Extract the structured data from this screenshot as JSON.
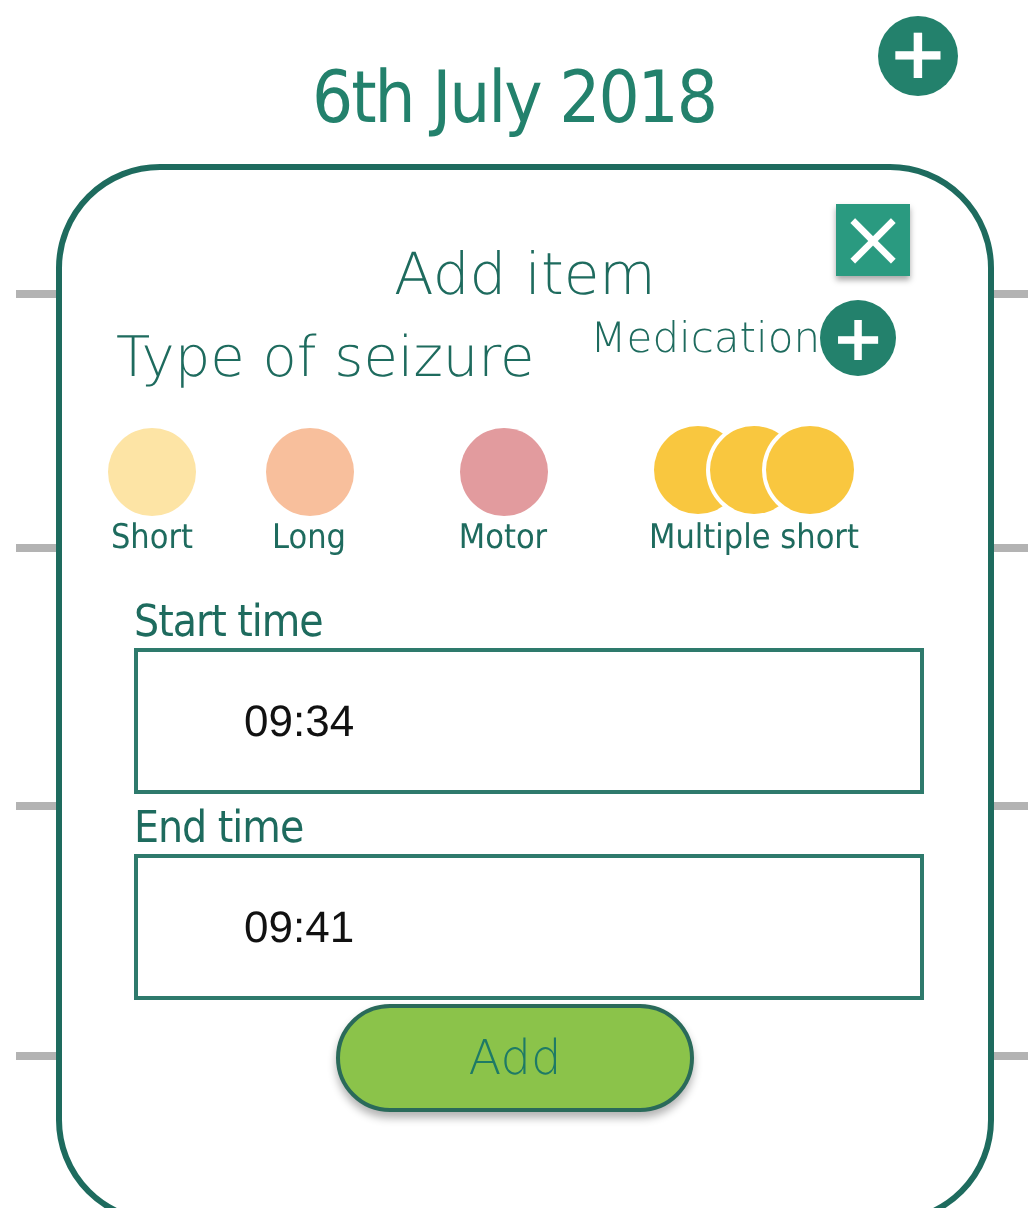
{
  "header": {
    "date": "6th July 2018",
    "add_button": "+"
  },
  "dialog": {
    "title": "Add item",
    "close": "×",
    "section_title": "Type of seizure",
    "medication": {
      "label": "Medication",
      "button": "+"
    },
    "seizure_types": [
      {
        "label": "Short",
        "kind": "single",
        "color": "#fde4a5"
      },
      {
        "label": "Long",
        "kind": "single",
        "color": "#f8bf9c"
      },
      {
        "label": "Motor",
        "kind": "single",
        "color": "#e29b9e"
      },
      {
        "label": "Multiple short",
        "kind": "multiple",
        "color": "#f9c73f"
      }
    ],
    "fields": [
      {
        "label": "Start time",
        "value": "09:34"
      },
      {
        "label": "End time",
        "value": "09:41"
      }
    ],
    "submit": "Add"
  }
}
